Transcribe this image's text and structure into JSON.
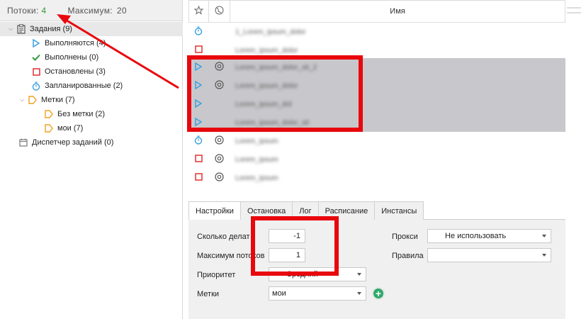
{
  "stats": {
    "threads_label": "Потоки:",
    "threads_value": "4",
    "max_label": "Максимум:",
    "max_value": "20"
  },
  "tree": {
    "tasks": "Задания (9)",
    "running": "Выполняются (4)",
    "done": "Выполнены (0)",
    "stopped": "Остановлены (3)",
    "scheduled": "Запланированные (2)",
    "labels": "Метки (7)",
    "no_label": "Без метки (2)",
    "mine": "мои (7)",
    "dispatcher": "Диспетчер заданий (0)"
  },
  "grid": {
    "name_header": "Имя",
    "rows": [
      {
        "name": "1_Lorem_ipsum_dolor"
      },
      {
        "name": "Lorem_ipsum_dolor"
      },
      {
        "name": "Lorem_ipsum_dolor_sit_2"
      },
      {
        "name": "Lorem_ipsum_dolor"
      },
      {
        "name": "Lorem_ipsum_dol"
      },
      {
        "name": "Lorem_ipsum_dolor_sit"
      },
      {
        "name": "Lorem_ipsum"
      },
      {
        "name": "Lorem_ipsum"
      },
      {
        "name": "Lorem_ipsum"
      }
    ]
  },
  "tabs": [
    "Настройки",
    "Остановка",
    "Лог",
    "Расписание",
    "Инстансы"
  ],
  "settings": {
    "how_many_label": "Сколько делат",
    "how_many_value": "-1",
    "max_threads_label": "Максимум потоков",
    "max_threads_value": "1",
    "priority_label": "Приоритет",
    "priority_value": "Средний",
    "labels_label": "Метки",
    "labels_value": "мои",
    "proxy_label": "Прокси",
    "proxy_value": "Не использовать",
    "rules_label": "Правила",
    "rules_value": ""
  },
  "colors": {
    "annotation_red": "#e8070d",
    "selection_gray": "#c8c8cc",
    "play_blue": "#3aa0e0",
    "stop_red": "#e03030",
    "check_green": "#2e9a3c",
    "label_orange": "#f0a020"
  }
}
